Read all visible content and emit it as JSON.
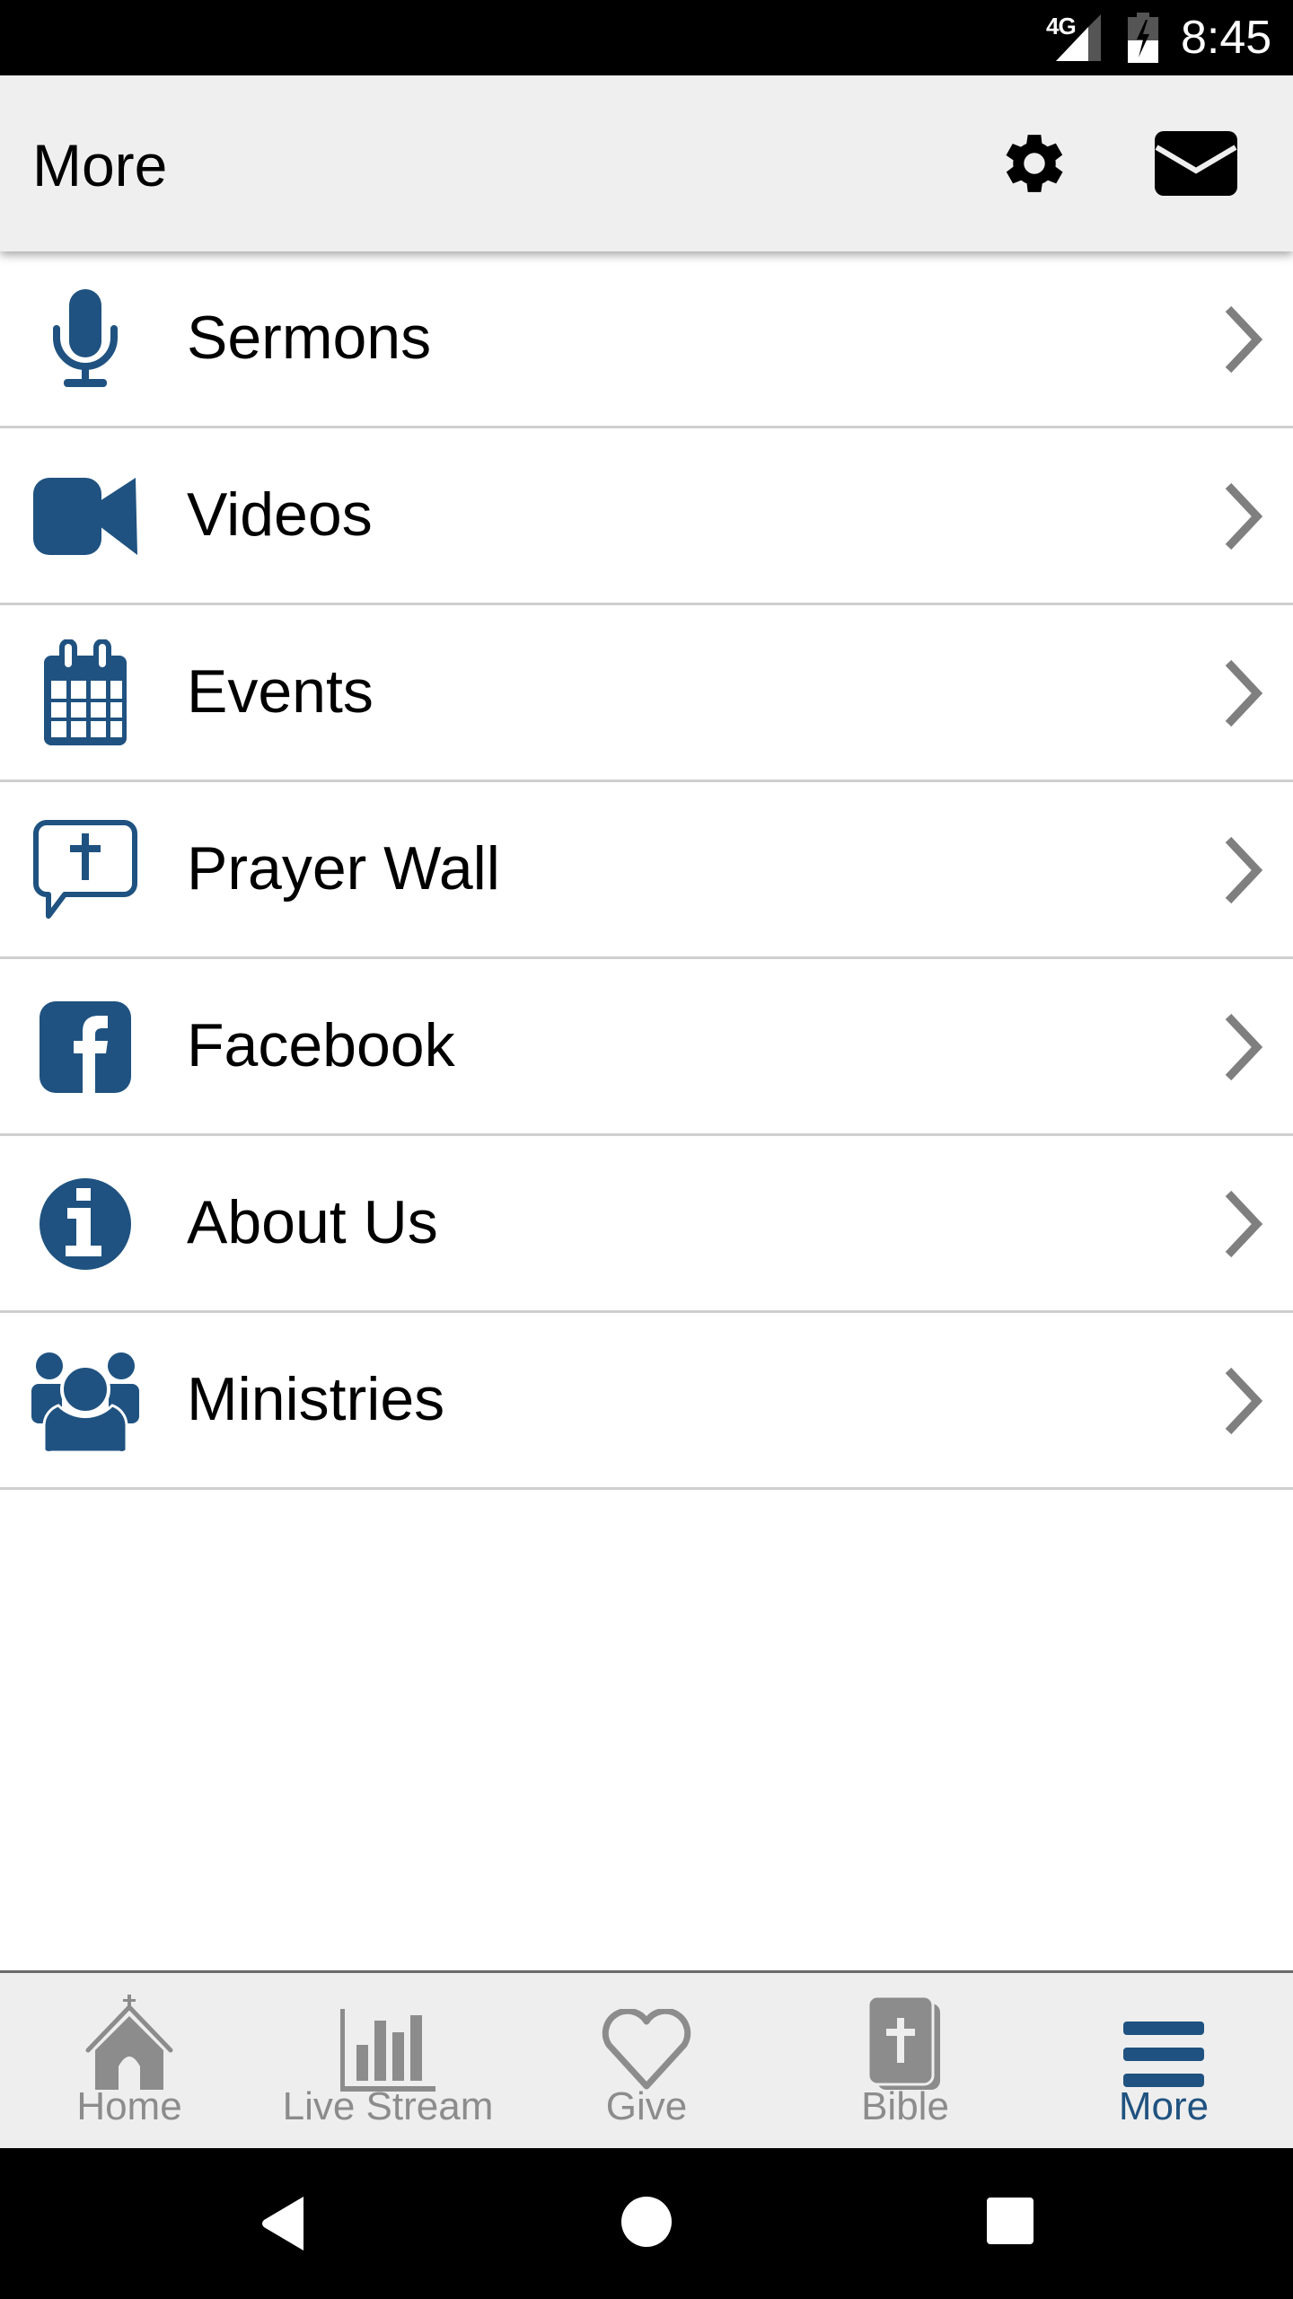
{
  "status_bar": {
    "network": "4G",
    "time": "8:45",
    "icons": [
      "signal-icon",
      "battery-charging-icon"
    ]
  },
  "app_bar": {
    "title": "More",
    "actions": [
      {
        "name": "settings",
        "icon": "gear-icon"
      },
      {
        "name": "messages",
        "icon": "envelope-icon"
      }
    ]
  },
  "menu": {
    "items": [
      {
        "label": "Sermons",
        "icon": "microphone-icon"
      },
      {
        "label": "Videos",
        "icon": "video-camera-icon"
      },
      {
        "label": "Events",
        "icon": "calendar-icon"
      },
      {
        "label": "Prayer Wall",
        "icon": "prayer-speech-bubble-icon"
      },
      {
        "label": "Facebook",
        "icon": "facebook-icon"
      },
      {
        "label": "About Us",
        "icon": "info-icon"
      },
      {
        "label": "Ministries",
        "icon": "group-icon"
      }
    ]
  },
  "bottom_nav": {
    "tabs": [
      {
        "label": "Home",
        "icon": "church-icon",
        "active": false
      },
      {
        "label": "Live Stream",
        "icon": "bar-chart-icon",
        "active": false
      },
      {
        "label": "Give",
        "icon": "heart-icon",
        "active": false
      },
      {
        "label": "Bible",
        "icon": "bible-icon",
        "active": false
      },
      {
        "label": "More",
        "icon": "hamburger-menu-icon",
        "active": true
      }
    ]
  },
  "colors": {
    "brand_blue": "#1f5280",
    "inactive_gray": "#8c8c8c",
    "chevron_gray": "#7f7f7f",
    "app_bar_bg": "#efefef"
  },
  "system_nav": {
    "buttons": [
      "back",
      "home",
      "recents"
    ]
  }
}
